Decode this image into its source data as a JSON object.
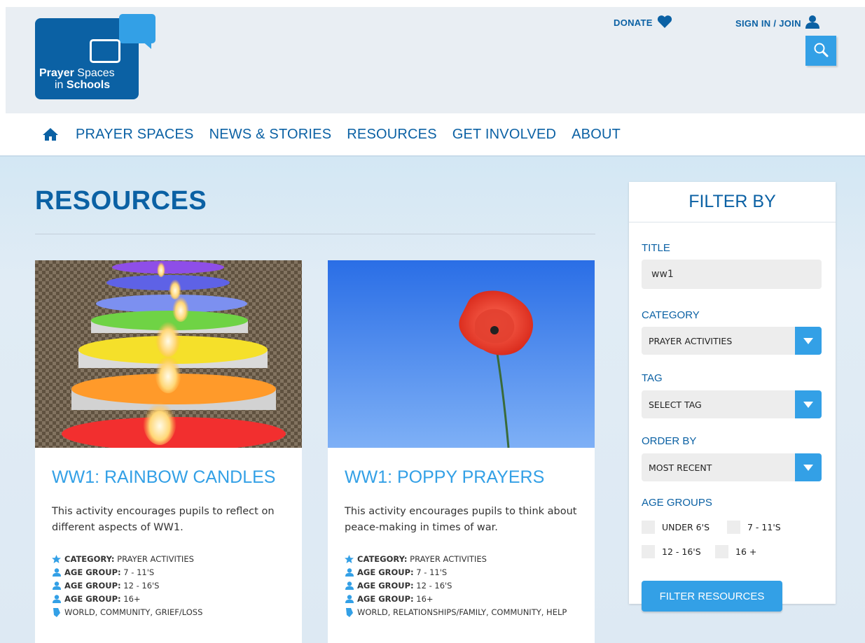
{
  "header": {
    "logo_line1_bold": "Prayer",
    "logo_line1_rest": " Spaces",
    "logo_line2_rest": "in ",
    "logo_line2_bold": "Schools",
    "donate_label": "DONATE",
    "signin_label": "SIGN IN / JOIN",
    "search_icon": "search-icon"
  },
  "nav": {
    "home_icon": "home-icon",
    "items": [
      "PRAYER SPACES",
      "NEWS & STORIES",
      "RESOURCES",
      "GET INVOLVED",
      "ABOUT"
    ]
  },
  "page": {
    "title": "RESOURCES"
  },
  "cards": [
    {
      "title": "WW1: RAINBOW CANDLES",
      "description": "This activity encourages pupils to reflect on different aspects of WW1.",
      "meta": [
        {
          "icon": "star-icon",
          "label": "CATEGORY:",
          "value": "PRAYER ACTIVITIES"
        },
        {
          "icon": "person-icon",
          "label": "AGE GROUP:",
          "value": "7 - 11'S"
        },
        {
          "icon": "person-icon",
          "label": "AGE GROUP:",
          "value": "12 - 16'S"
        },
        {
          "icon": "person-icon",
          "label": "AGE GROUP:",
          "value": "16+"
        },
        {
          "icon": "tag-icon",
          "label": "",
          "value": "WORLD, COMMUNITY, GRIEF/LOSS"
        }
      ]
    },
    {
      "title": "WW1: POPPY PRAYERS",
      "description": "This activity encourages pupils to think about peace-making in times of war.",
      "meta": [
        {
          "icon": "star-icon",
          "label": "CATEGORY:",
          "value": "PRAYER ACTIVITIES"
        },
        {
          "icon": "person-icon",
          "label": "AGE GROUP:",
          "value": "7 - 11'S"
        },
        {
          "icon": "person-icon",
          "label": "AGE GROUP:",
          "value": "12 - 16'S"
        },
        {
          "icon": "person-icon",
          "label": "AGE GROUP:",
          "value": "16+"
        },
        {
          "icon": "tag-icon",
          "label": "",
          "value": "WORLD, RELATIONSHIPS/FAMILY, COMMUNITY, HELP"
        }
      ]
    }
  ],
  "filter": {
    "heading": "FILTER BY",
    "title_label": "TITLE",
    "title_value": "ww1",
    "category_label": "CATEGORY",
    "category_value": "PRAYER ACTIVITIES",
    "tag_label": "TAG",
    "tag_value": "SELECT TAG",
    "order_label": "ORDER BY",
    "order_value": "MOST RECENT",
    "age_label": "AGE GROUPS",
    "age_options": [
      "UNDER 6'S",
      "7 - 11'S",
      "12 - 16'S",
      "16 +"
    ],
    "button_label": "FILTER RESOURCES"
  },
  "colors": {
    "brand_dark": "#0b61a4",
    "brand_accent": "#33a0e6"
  }
}
